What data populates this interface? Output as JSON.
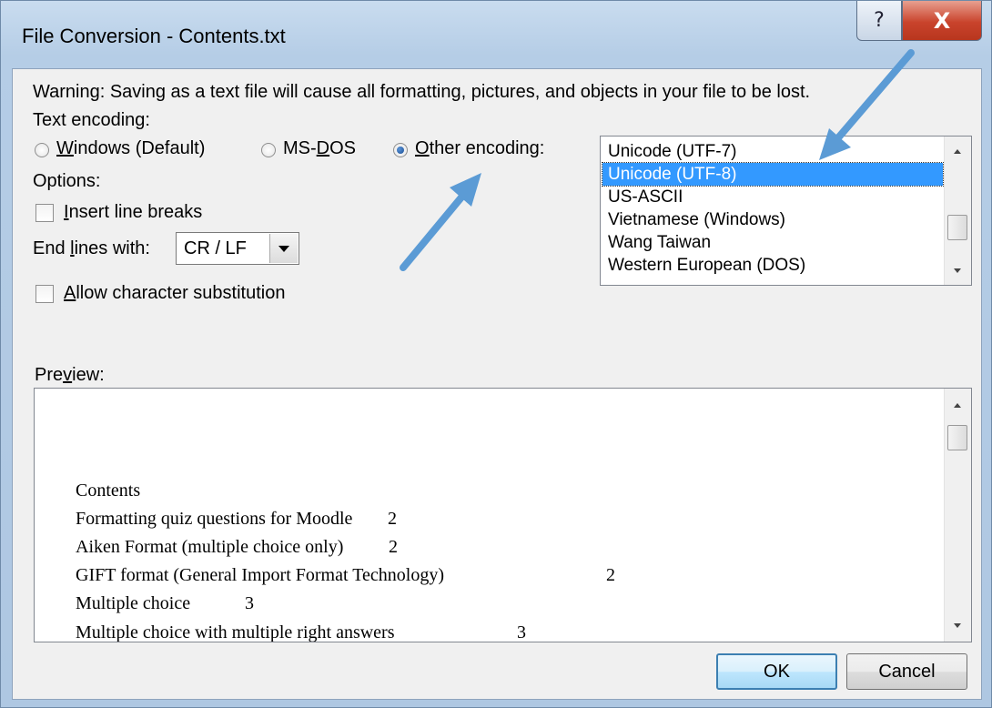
{
  "window": {
    "title": "File Conversion - Contents.txt",
    "help_glyph": "?",
    "close_glyph": "X"
  },
  "warning": "Warning: Saving as a text file will cause all formatting, pictures, and objects in your file to be lost.",
  "encoding": {
    "label": "Text encoding:",
    "options": [
      {
        "pre": "",
        "key": "W",
        "post": "indows (Default)",
        "selected": false
      },
      {
        "pre": "MS-",
        "key": "D",
        "post": "OS",
        "selected": false
      },
      {
        "pre": "",
        "key": "O",
        "post": "ther encoding:",
        "selected": true
      }
    ],
    "list": {
      "items": [
        "Unicode (UTF-7)",
        "Unicode (UTF-8)",
        "US-ASCII",
        "Vietnamese (Windows)",
        "Wang Taiwan",
        "Western European (DOS)"
      ],
      "selected": "Unicode (UTF-8)"
    }
  },
  "options": {
    "label": "Options:",
    "insert_line_breaks": {
      "key": "I",
      "rest": "nsert line breaks",
      "checked": false
    },
    "end_lines": {
      "pre": "End ",
      "key": "l",
      "post": "ines with:",
      "value": "CR / LF"
    },
    "allow_substitution": {
      "key": "A",
      "rest": "llow character substitution",
      "checked": false
    }
  },
  "preview": {
    "label_pre": "Pre",
    "label_key": "v",
    "label_post": "iew:",
    "lines": [
      {
        "text": "Contents",
        "page": ""
      },
      {
        "text": "Formatting quiz questions for Moodle",
        "page": "2"
      },
      {
        "text": "Aiken Format (multiple choice only)",
        "page": "2"
      },
      {
        "text": "GIFT format (General Import Format Technology)",
        "page": "2"
      },
      {
        "text": "Multiple choice",
        "page": "3"
      },
      {
        "text": "Multiple choice with multiple right answers",
        "page": "3"
      }
    ]
  },
  "buttons": {
    "ok": "OK",
    "cancel": "Cancel"
  },
  "colors": {
    "selection": "#3399ff",
    "annotation_arrow": "#5b9bd5",
    "close_button": "#c9432c"
  }
}
